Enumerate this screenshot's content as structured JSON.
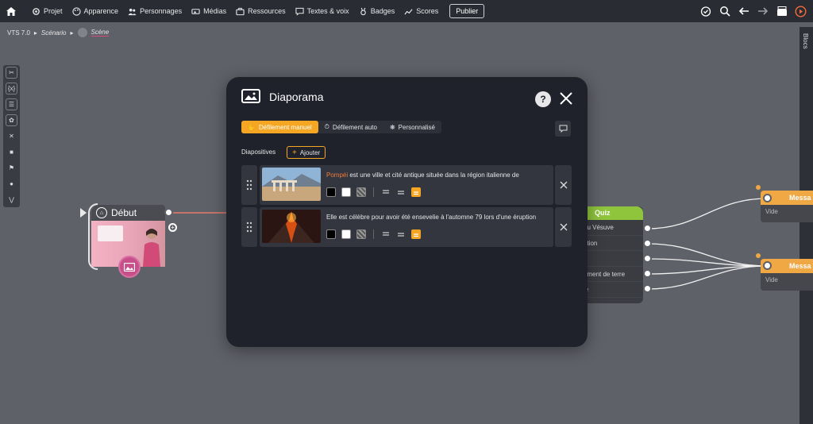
{
  "nav": {
    "items": [
      {
        "label": "Projet",
        "icon": "gear-icon"
      },
      {
        "label": "Apparence",
        "icon": "palette-icon"
      },
      {
        "label": "Personnages",
        "icon": "people-icon"
      },
      {
        "label": "Médias",
        "icon": "media-icon"
      },
      {
        "label": "Ressources",
        "icon": "briefcase-icon"
      },
      {
        "label": "Textes & voix",
        "icon": "speech-icon"
      },
      {
        "label": "Badges",
        "icon": "badge-icon"
      },
      {
        "label": "Scores",
        "icon": "chart-icon"
      }
    ],
    "publish": "Publier"
  },
  "breadcrumb": {
    "version": "VTS 7.0",
    "scenario": "Scénario",
    "scene": "Scène"
  },
  "blocs_tab": "Blocs",
  "debut": {
    "label": "Début"
  },
  "quiz": {
    "title": "Quiz",
    "rows": [
      "du Vésuve",
      "ation",
      "e",
      "ement de terre",
      "ie"
    ]
  },
  "messages": [
    {
      "title": "Messa",
      "body": "Vide"
    },
    {
      "title": "Messa",
      "body": "Vide"
    }
  ],
  "modal": {
    "title": "Diaporama",
    "help": "?",
    "tabs": [
      {
        "label": "Défilement manuel",
        "active": true
      },
      {
        "label": "Défilement auto",
        "active": false
      },
      {
        "label": "Personnalisé",
        "active": false
      }
    ],
    "slides_label": "Diapositives",
    "add_label": "Ajouter",
    "slides": [
      {
        "highlight": "Pompéi",
        "text": " est une ville et cité antique située dans la région italienne de"
      },
      {
        "highlight": "",
        "text": "Elle est célèbre pour avoir été ensevelie à l'automne 79 lors d'une éruption"
      }
    ]
  },
  "colors": {
    "accent": "#f5a623",
    "quiz": "#8fc43d",
    "message": "#f0a844",
    "debut_thumb": "#e8a4b8"
  }
}
